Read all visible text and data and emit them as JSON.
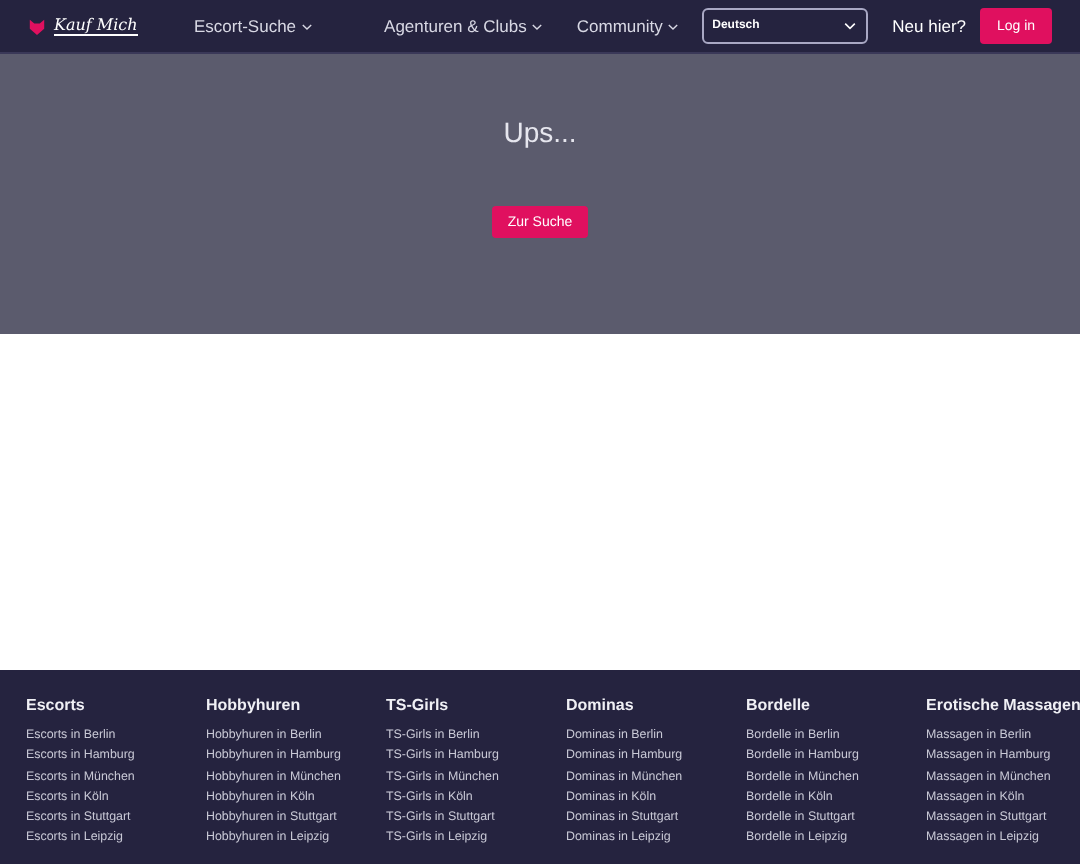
{
  "header": {
    "logo": "Kauf Mich",
    "nav": [
      {
        "label": "Escort-Suche"
      },
      {
        "label": "Agenturen & Clubs"
      },
      {
        "label": "Community"
      }
    ],
    "language_select": {
      "value": "Deutsch"
    },
    "signup_prompt": "Neu hier?",
    "login_button": "Log in"
  },
  "hero": {
    "title": "Ups...",
    "button": "Zur Suche"
  },
  "footer": {
    "columns": [
      {
        "title": "Escorts",
        "links": [
          "Escorts in Berlin",
          "Escorts in Hamburg",
          "Escorts in München",
          "Escorts in Köln",
          "Escorts in Stuttgart",
          "Escorts in Leipzig"
        ]
      },
      {
        "title": "Hobbyhuren",
        "links": [
          "Hobbyhuren in Berlin",
          "Hobbyhuren in Hamburg",
          "Hobbyhuren in München",
          "Hobbyhuren in Köln",
          "Hobbyhuren in Stuttgart",
          "Hobbyhuren in Leipzig"
        ]
      },
      {
        "title": "TS-Girls",
        "links": [
          "TS-Girls in Berlin",
          "TS-Girls in Hamburg",
          "TS-Girls in München",
          "TS-Girls in Köln",
          "TS-Girls in Stuttgart",
          "TS-Girls in Leipzig"
        ]
      },
      {
        "title": "Dominas",
        "links": [
          "Dominas in Berlin",
          "Dominas in Hamburg",
          "Dominas in München",
          "Dominas in Köln",
          "Dominas in Stuttgart",
          "Dominas in Leipzig"
        ]
      },
      {
        "title": "Bordelle",
        "links": [
          "Bordelle in Berlin",
          "Bordelle in Hamburg",
          "Bordelle in München",
          "Bordelle in Köln",
          "Bordelle in Stuttgart",
          "Bordelle in Leipzig"
        ]
      },
      {
        "title": "Erotische Massagen",
        "links": [
          "Massagen in Berlin",
          "Massagen in Hamburg",
          "Massagen in München",
          "Massagen in Köln",
          "Massagen in Stuttgart",
          "Massagen in Leipzig"
        ]
      }
    ]
  }
}
